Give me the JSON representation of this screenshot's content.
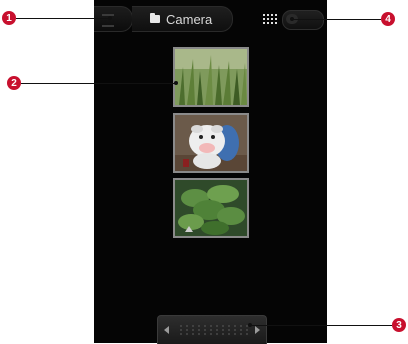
{
  "topbar": {
    "breadcrumb_label": "Camera"
  },
  "thumbnails": [
    {
      "subject": "grass"
    },
    {
      "subject": "cow-toy"
    },
    {
      "subject": "leafy-plant"
    }
  ],
  "callouts": [
    "1",
    "2",
    "3",
    "4"
  ],
  "colors": {
    "background": "#050505",
    "badge": "#c8102e",
    "thumb_border": "#8a8a8a"
  }
}
